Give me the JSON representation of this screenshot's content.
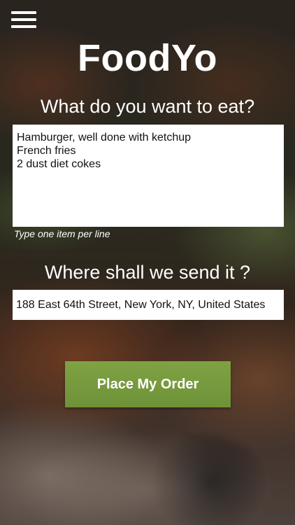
{
  "header": {
    "menu_icon": "hamburger-menu-icon",
    "app_title": "FoodYo"
  },
  "order": {
    "question": "What do you want to eat?",
    "items": [
      "Hamburger, well done with ketchup",
      "French fries",
      "2 dust diet cokes"
    ],
    "hint": "Type one item per line"
  },
  "delivery": {
    "question": "Where shall we send it ?",
    "address": "188 East 64th Street, New York, NY, United States"
  },
  "actions": {
    "place_order_label": "Place My Order",
    "button_color": "#7a9d40"
  }
}
